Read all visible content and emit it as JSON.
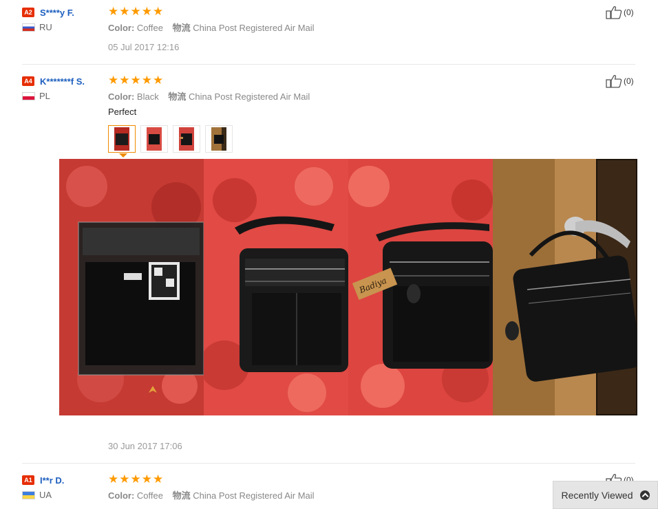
{
  "reviews": [
    {
      "level": "A2",
      "user": "S****y F.",
      "country": "RU",
      "color_label": "Color:",
      "color_value": "Coffee",
      "logistics_label": "物流",
      "logistics_value": "China Post Registered Air Mail",
      "date": "05 Jul 2017 12:16",
      "helpful_count": "(0)"
    },
    {
      "level": "A4",
      "user": "K*******f S.",
      "country": "PL",
      "color_label": "Color:",
      "color_value": "Black",
      "logistics_label": "物流",
      "logistics_value": "China Post Registered Air Mail",
      "text": "Perfect",
      "date": "30 Jun 2017 17:06",
      "helpful_count": "(0)"
    },
    {
      "level": "A1",
      "user": "I**r D.",
      "country": "UA",
      "color_label": "Color:",
      "color_value": "Coffee",
      "logistics_label": "物流",
      "logistics_value": "China Post Registered Air Mail",
      "helpful_count": "(0)"
    }
  ],
  "rating_stars": "★",
  "recently_viewed": "Recently Viewed",
  "colors": {
    "accent": "#ff9a00",
    "badge": "#e62e04",
    "link": "#1d5fbf"
  }
}
